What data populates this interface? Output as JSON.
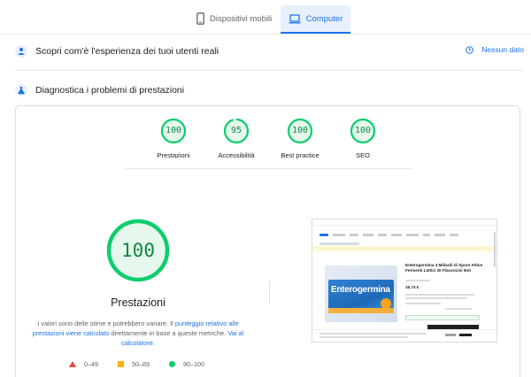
{
  "tabs": [
    {
      "label": "Dispositivi mobili",
      "icon": "smartphone-icon",
      "selected": false
    },
    {
      "label": "Computer",
      "icon": "laptop-icon",
      "selected": true
    }
  ],
  "field_data": {
    "title": "Scopri com'è l'esperienza dei tuoi utenti reali",
    "status": "Nessun dato",
    "status_icon": "clock-icon"
  },
  "lab_data": {
    "title": "Diagnostica i problemi di prestazioni"
  },
  "scores": [
    {
      "label": "Prestazioni",
      "value": 100
    },
    {
      "label": "Accessibilità",
      "value": 95
    },
    {
      "label": "Best practice",
      "value": 100
    },
    {
      "label": "SEO",
      "value": 100
    }
  ],
  "main_score": {
    "value": 100,
    "title": "Prestazioni",
    "desc_part1": "I valori sono delle stime e potrebbero variare. Il ",
    "desc_link1": "punteggio relativo alle prestazioni viene calcolato",
    "desc_part2": " direttamente in base a queste metriche. ",
    "desc_link2": "Vai al calcolatore."
  },
  "legend": [
    {
      "range": "0–49",
      "shape": "triangle",
      "color": "#e8453c"
    },
    {
      "range": "50–89",
      "shape": "square",
      "color": "#f4b400"
    },
    {
      "range": "90–100",
      "shape": "circle",
      "color": "#0cce6b"
    }
  ],
  "thumbnail": {
    "brand": "Enterogermina",
    "product_title": "Enterogermina 4 Miliardi di Spore Attive Fermenti Lattici 20 Flaconcini 5ml",
    "price": "16,74 €"
  },
  "colors": {
    "accent": "#1a73e8",
    "pass": "#0cce6b",
    "pass_text": "#0c8a3c",
    "pass_bg": "#e6f7ee"
  }
}
